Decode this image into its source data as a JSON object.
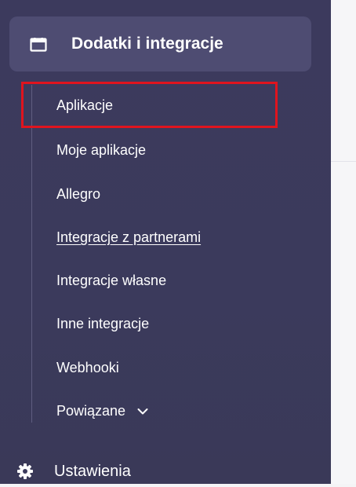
{
  "sidebar": {
    "section": {
      "label": "Dodatki i integracje",
      "icon": "calendar-window-icon"
    },
    "items": [
      {
        "label": "Aplikacje",
        "highlighted": true
      },
      {
        "label": "Moje aplikacje"
      },
      {
        "label": "Allegro"
      },
      {
        "label": "Integracje z partnerami",
        "underlined": true
      },
      {
        "label": "Integracje własne"
      },
      {
        "label": "Inne integracje"
      },
      {
        "label": "Webhooki"
      },
      {
        "label": "Powiązane",
        "icon": "chevron-down-icon"
      }
    ],
    "settings": {
      "label": "Ustawienia",
      "icon": "gear-icon"
    }
  },
  "colors": {
    "sidebar_bg": "#3c3a5d",
    "active_section_bg": "#4e4c72",
    "highlight_border": "#e0141e",
    "text": "#ffffff"
  }
}
